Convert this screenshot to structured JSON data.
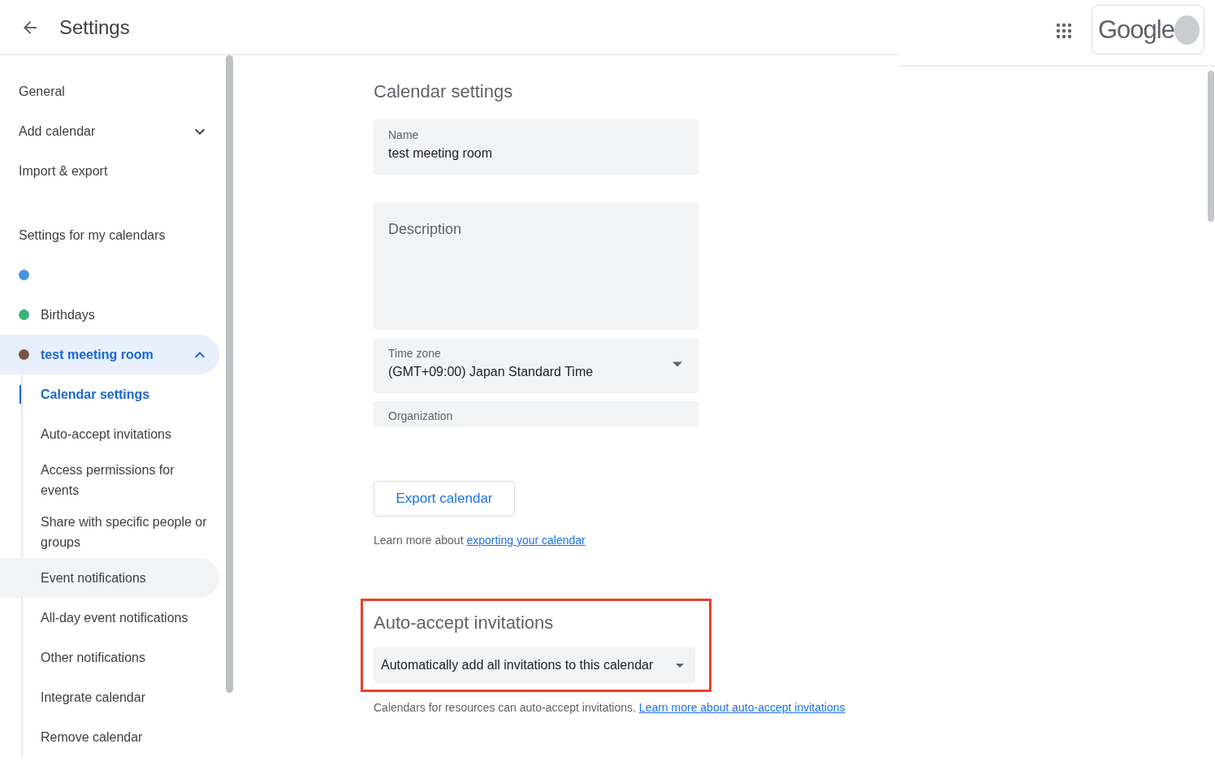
{
  "header": {
    "title": "Settings"
  },
  "account": {
    "logo_text": "Google"
  },
  "sidebar": {
    "items": [
      {
        "kind": "link",
        "label": "General"
      },
      {
        "kind": "expander",
        "label": "Add calendar",
        "expanded": false
      },
      {
        "kind": "link",
        "label": "Import & export"
      }
    ],
    "section_title": "Settings for my calendars",
    "calendars": [
      {
        "color": "#4594e0",
        "selected": false
      },
      {
        "label": "Birthdays",
        "color": "#33b679",
        "selected": false
      },
      {
        "label": "test meeting room",
        "color": "#795548",
        "selected": true,
        "expanded": true,
        "children": [
          {
            "label": "Calendar settings",
            "selected": true,
            "hovered": false
          },
          {
            "label": "Auto-accept invitations",
            "selected": false,
            "hovered": false
          },
          {
            "label": "Access permissions for events",
            "selected": false,
            "hovered": false
          },
          {
            "label": "Share with specific people or groups",
            "selected": false,
            "hovered": false
          },
          {
            "label": "Event notifications",
            "selected": false,
            "hovered": true
          },
          {
            "label": "All-day event notifications",
            "selected": false,
            "hovered": false
          },
          {
            "label": "Other notifications",
            "selected": false,
            "hovered": false
          },
          {
            "label": "Integrate calendar",
            "selected": false,
            "hovered": false
          },
          {
            "label": "Remove calendar",
            "selected": false,
            "hovered": false
          }
        ]
      }
    ]
  },
  "main": {
    "section_title": "Calendar settings",
    "fields": [
      {
        "kind": "text",
        "label": "Name",
        "value": "test meeting room"
      },
      {
        "kind": "textarea",
        "placeholder": "Description"
      },
      {
        "kind": "select",
        "label": "Time zone",
        "value": "(GMT+09:00) Japan Standard Time"
      },
      {
        "kind": "cut",
        "label": "Organization"
      }
    ],
    "export_button": "Export calendar",
    "export_note": {
      "text": "Learn more about",
      "link": "exporting your calendar"
    },
    "auto_accept": {
      "title": "Auto-accept invitations",
      "highlighted": true,
      "value": "Automatically add all invitations to this calendar",
      "note": "Calendars for resources can auto-accept invitations.",
      "link": "Learn more about auto-accept invitations"
    }
  }
}
